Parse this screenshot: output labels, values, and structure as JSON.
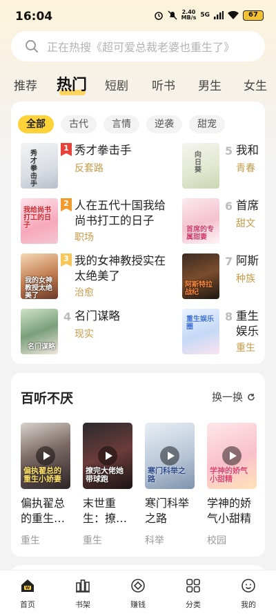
{
  "status": {
    "time": "16:04",
    "speed_top": "2.40",
    "speed_bottom": "MB/s",
    "net": "5G",
    "battery": "67"
  },
  "search": {
    "placeholder": "正在热搜《超可爱总裁老婆也重生了》"
  },
  "tabs": [
    "推荐",
    "热门",
    "短剧",
    "听书",
    "男生",
    "女生"
  ],
  "active_tab": "热门",
  "chips": [
    "全部",
    "古代",
    "言情",
    "逆袭",
    "甜宠"
  ],
  "ranking": [
    {
      "rank": "1",
      "title": "秀才拳击手",
      "tag": "反套路",
      "cover_text": "秀才拳击手"
    },
    {
      "rank": "2",
      "title": "人在五代十国我给尚书打工的日子",
      "title_l1": "人在五代十国我给",
      "title_l2": "尚书打工的日子",
      "tag": "职场",
      "cover_text": "我给尚书打工的日子"
    },
    {
      "rank": "3",
      "title": "我的女神教授实在太绝美了",
      "title_l1": "我的女神教授实在",
      "title_l2": "太绝美了",
      "tag": "治愈",
      "cover_text": "我的女神教授太绝美了"
    },
    {
      "rank": "4",
      "title": "名门谋略",
      "tag": "现实",
      "cover_text": "名门谋略"
    },
    {
      "rank": "5",
      "title": "我和",
      "tag": "青春",
      "cover_text": "向日葵"
    },
    {
      "rank": "6",
      "title": "首席",
      "tag": "甜文",
      "cover_text": "首席的专属甜妻"
    },
    {
      "rank": "7",
      "title": "阿斯",
      "tag": "种族",
      "cover_text": "阿斯特拉战纪"
    },
    {
      "rank": "8",
      "title_l1": "重生",
      "title_l2": "娱乐",
      "tag": "重生",
      "cover_text": "重生娱乐圈"
    }
  ],
  "section2": {
    "title": "百听不厌",
    "swap_label": "换一换",
    "books": [
      {
        "title_l1": "偏执翟总",
        "title_l2": "的重生…",
        "genre": "重生",
        "cover_text": "偏执翟总的重生小娇妻"
      },
      {
        "title_l1": "末世重",
        "title_l2": "生：撩…",
        "genre": "重生",
        "cover_text": "撩完大佬她带球跑"
      },
      {
        "title_l1": "寒门科举",
        "title_l2": "之路",
        "genre": "科举",
        "cover_text": "寒门科举之路"
      },
      {
        "title_l1": "学神的娇",
        "title_l2": "气小甜精",
        "genre": "校园",
        "cover_text": "学神的娇气小甜精"
      }
    ]
  },
  "nav": [
    {
      "label": "首页",
      "icon": "home-icon"
    },
    {
      "label": "书架",
      "icon": "bookshelf-icon"
    },
    {
      "label": "赚钱",
      "icon": "earn-icon"
    },
    {
      "label": "分类",
      "icon": "category-icon"
    },
    {
      "label": "我的",
      "icon": "profile-icon"
    }
  ],
  "colors": {
    "accent": "#ffd23a",
    "tag": "#c89a48",
    "rank1": "#e8413a",
    "rank2": "#f29a2e",
    "rank3": "#f7c75b"
  }
}
